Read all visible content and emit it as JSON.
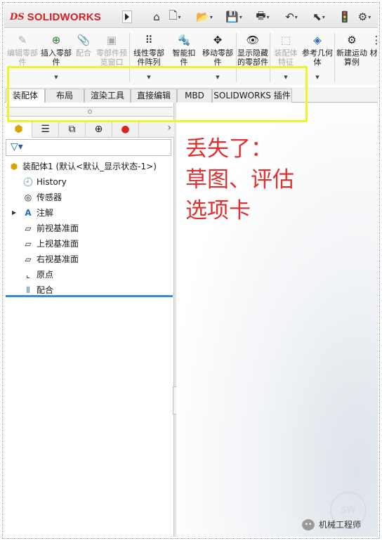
{
  "app": {
    "logo_ds": "DS",
    "logo_name": "SOLIDWORKS"
  },
  "quick_access": [
    {
      "icon": "home-icon",
      "glyph": "⌂"
    },
    {
      "icon": "new-document-icon",
      "glyph": "🗋"
    },
    {
      "icon": "open-icon",
      "glyph": "↗"
    },
    {
      "icon": "save-icon",
      "glyph": "💾"
    },
    {
      "icon": "print-icon",
      "glyph": "🖶"
    },
    {
      "icon": "undo-icon",
      "glyph": "↶"
    },
    {
      "icon": "select-icon",
      "glyph": "⬉"
    },
    {
      "icon": "traffic-light-icon",
      "glyph": "🚦"
    }
  ],
  "ribbon": {
    "edit_component": "编辑零部件",
    "insert_component": "插入零部件",
    "mate": "配合",
    "component_preview": "零部件预览窗口",
    "linear_pattern": "线性零部件阵列",
    "smart_fasteners": "智能扣件",
    "move_component": "移动零部件",
    "show_hidden": "显示隐藏的零部件",
    "assembly_features": "装配体特征",
    "reference_geometry": "参考几何体",
    "new_motion_study": "新建运动算例",
    "more": "材"
  },
  "tabs": [
    "装配体",
    "布局",
    "渲染工具",
    "直接编辑",
    "MBD",
    "SOLIDWORKS 插件"
  ],
  "panel_tabs": [
    "feature-manager-icon",
    "property-manager-icon",
    "configuration-manager-icon",
    "dimxpert-icon",
    "display-manager-icon"
  ],
  "tree": {
    "root": "装配体1 (默认<默认_显示状态-1>)",
    "items": [
      "History",
      "传感器",
      "注解",
      "前视基准面",
      "上视基准面",
      "右视基准面",
      "原点",
      "配合"
    ]
  },
  "annotation": {
    "line1": "丢失了：",
    "line2": "草图、评估",
    "line3": "选项卡"
  },
  "watermark": {
    "badge": "SW",
    "account": "机械工程师"
  },
  "colors": {
    "brand": "#d81f26",
    "annotation": "#e03030",
    "highlight": "#f2f226",
    "tree_accent": "#3a8ccf"
  }
}
